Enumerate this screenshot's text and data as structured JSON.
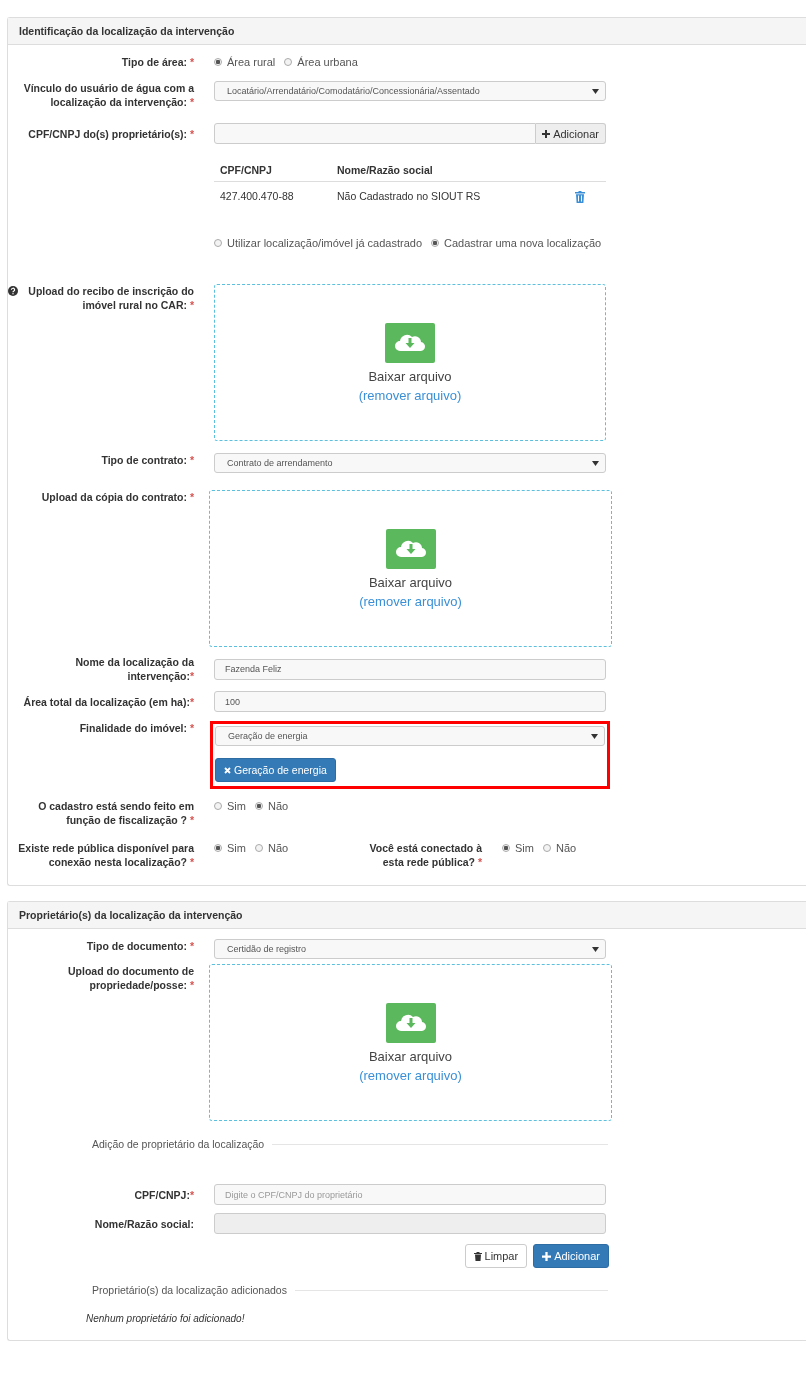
{
  "sections": [
    {
      "title": "Identificação da localização da intervenção",
      "fields": [
        {
          "kind": "radio",
          "label": "Tipo de área:",
          "mark": "*",
          "options": [
            {
              "label": "Área rural",
              "selected": true
            },
            {
              "label": "Área urbana",
              "selected": false
            }
          ]
        },
        {
          "kind": "select",
          "label": "Vínculo do usuário de água com a localização da intervenção:",
          "mark": "*",
          "value": "Locatário/Arrendatário/Comodatário/Concessionária/Assentado"
        },
        {
          "kind": "input_add",
          "label": "CPF/CNPJ do(s) proprietário(s):",
          "mark": "*",
          "button": "Adicionar"
        },
        {
          "kind": "table",
          "columns": [
            "CPF/CNPJ",
            "Nome/Razão social"
          ],
          "rows": [
            {
              "cells": [
                "427.400.470-88",
                "Não Cadastrado no SIOUT RS"
              ]
            }
          ]
        },
        {
          "kind": "radio",
          "options": [
            {
              "label": "Utilizar localização/imóvel já cadastrado",
              "selected": false
            },
            {
              "label": "Cadastrar uma nova localização",
              "selected": true
            }
          ]
        },
        {
          "kind": "upload",
          "help": true,
          "label": "Upload do recibo de inscrição do imóvel rural no CAR:",
          "mark": "*",
          "action": "Baixar arquivo",
          "link": "(remover arquivo)"
        },
        {
          "kind": "select",
          "label": "Tipo de contrato:",
          "mark": "*",
          "value": "Contrato de arrendamento"
        },
        {
          "kind": "upload",
          "wide": true,
          "label": "Upload da cópia do contrato:",
          "mark": "*",
          "action": "Baixar arquivo",
          "link": "(remover arquivo)"
        },
        {
          "kind": "input",
          "label": "Nome da localização da intervenção:",
          "mark": "*",
          "value": "Fazenda Feliz"
        },
        {
          "kind": "input",
          "label": "Área total da localização (em ha):",
          "mark": "*",
          "value": "100"
        },
        {
          "kind": "multiselect",
          "highlighted": true,
          "label": "Finalidade do imóvel:",
          "mark": "*",
          "value": "Geração de energia",
          "tags": [
            "Geração de energia"
          ]
        },
        {
          "kind": "radio",
          "label": "O cadastro está sendo feito em função de fiscalização ?",
          "mark": "*",
          "options": [
            {
              "label": "Sim",
              "selected": false
            },
            {
              "label": "Não",
              "selected": true
            }
          ]
        },
        {
          "kind": "radio_pair",
          "groups": [
            {
              "label": "Existe rede pública disponível para conexão nesta localização?",
              "mark": "*",
              "options": [
                {
                  "label": "Sim",
                  "selected": true
                },
                {
                  "label": "Não",
                  "selected": false
                }
              ]
            },
            {
              "label": "Você está conectado à esta rede pública?",
              "mark": "*",
              "options": [
                {
                  "label": "Sim",
                  "selected": true
                },
                {
                  "label": "Não",
                  "selected": false
                }
              ]
            }
          ]
        }
      ]
    },
    {
      "title": "Proprietário(s) da localização da intervenção",
      "fields": [
        {
          "kind": "select",
          "label": "Tipo de documento:",
          "mark": "*",
          "value": "Certidão de registro"
        },
        {
          "kind": "upload",
          "wide": true,
          "label": "Upload do documento de propriedade/posse:",
          "mark": "*",
          "action": "Baixar arquivo",
          "link": "(remover arquivo)"
        },
        {
          "kind": "legend",
          "text": "Adição de proprietário da localização"
        },
        {
          "kind": "input",
          "label": "CPF/CNPJ:",
          "mark": "*",
          "placeholder": "Digite o CPF/CNPJ do proprietário"
        },
        {
          "kind": "input",
          "label": "Nome/Razão social:",
          "disabled": true
        },
        {
          "kind": "buttons",
          "buttons": [
            {
              "label": "Limpar",
              "kind": "default"
            },
            {
              "label": "Adicionar",
              "kind": "primary"
            }
          ]
        },
        {
          "kind": "legend",
          "text": "Proprietário(s) da localização adicionados"
        },
        {
          "kind": "note",
          "text": "Nenhum proprietário foi adicionado!"
        }
      ]
    }
  ]
}
